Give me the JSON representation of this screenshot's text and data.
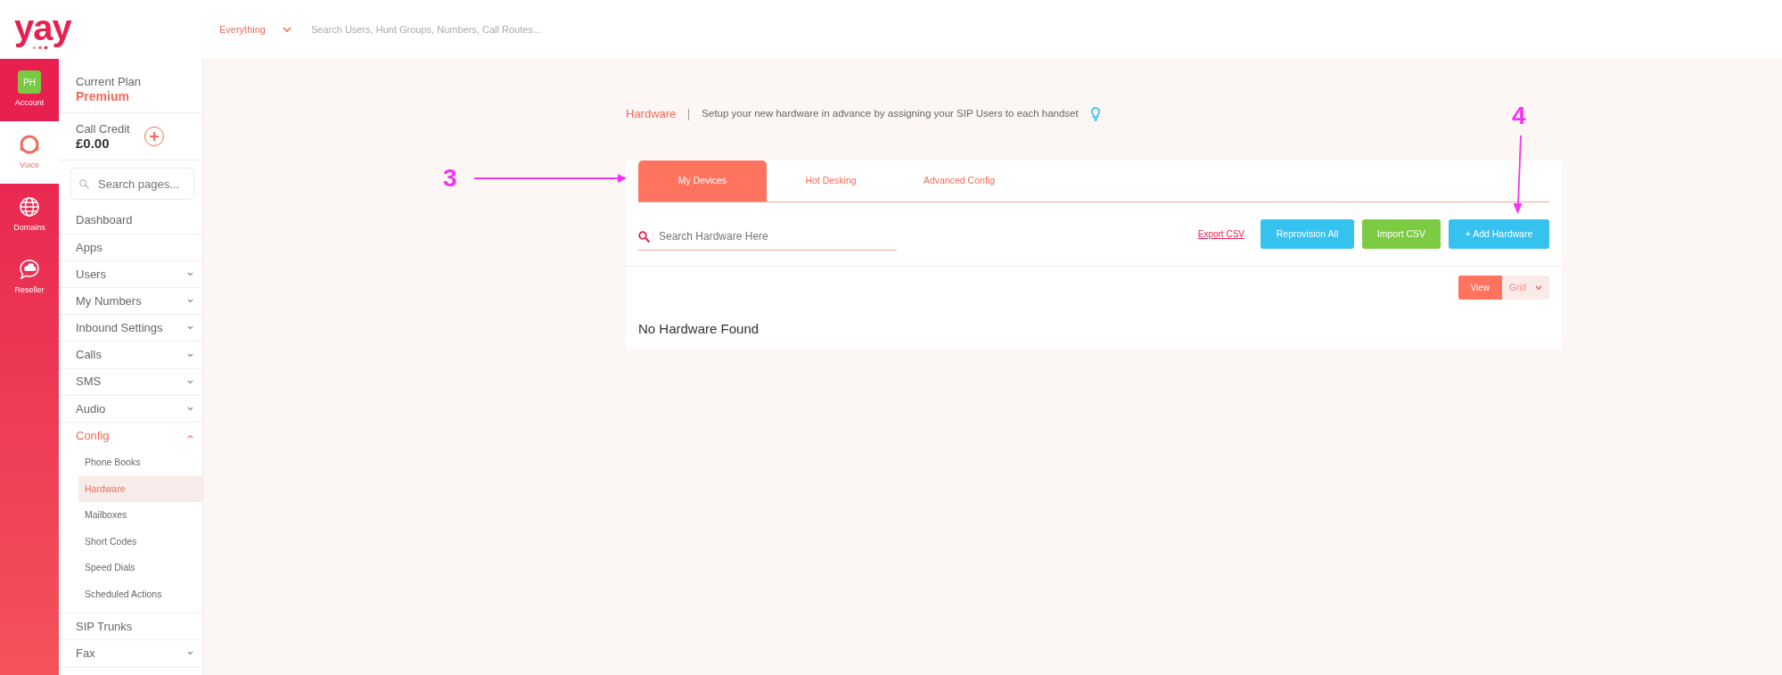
{
  "logo": {
    "text": "yay"
  },
  "header": {
    "scope": "Everything",
    "search_placeholder": "Search Users, Hunt Groups, Numbers, Call Routes..."
  },
  "rail": [
    {
      "label": "Account",
      "avatar": "PH",
      "selected": false
    },
    {
      "label": "Voice",
      "selected": true
    },
    {
      "label": "Domains",
      "selected": false
    },
    {
      "label": "Reseller",
      "selected": false
    }
  ],
  "plan": {
    "label": "Current Plan",
    "value": "Premium"
  },
  "credit": {
    "label": "Call Credit",
    "value": "£0.00"
  },
  "sidebar_search": {
    "placeholder": "Search pages..."
  },
  "nav": [
    {
      "label": "Dashboard"
    },
    {
      "label": "Apps"
    },
    {
      "label": "Users",
      "expanded": false
    },
    {
      "label": "My Numbers",
      "expanded": false
    },
    {
      "label": "Inbound Settings",
      "expanded": false
    },
    {
      "label": "Calls",
      "expanded": false
    },
    {
      "label": "SMS",
      "expanded": false
    },
    {
      "label": "Audio",
      "expanded": false
    },
    {
      "label": "Config",
      "expanded": true,
      "children": [
        {
          "label": "Phone Books",
          "selected": false
        },
        {
          "label": "Hardware",
          "selected": true
        },
        {
          "label": "Mailboxes",
          "selected": false
        },
        {
          "label": "Short Codes",
          "selected": false
        },
        {
          "label": "Speed Dials",
          "selected": false
        },
        {
          "label": "Scheduled Actions",
          "selected": false
        }
      ]
    },
    {
      "label": "SIP Trunks"
    },
    {
      "label": "Fax",
      "expanded": false
    }
  ],
  "page": {
    "title": "Hardware",
    "description": "Setup your new hardware in advance by assigning your SIP Users to each handset",
    "tabs": [
      {
        "label": "My Devices",
        "selected": true
      },
      {
        "label": "Hot Desking",
        "selected": false
      },
      {
        "label": "Advanced Config",
        "selected": false
      }
    ],
    "search": {
      "placeholder": "Search Hardware Here"
    },
    "export_link": "Export CSV",
    "buttons": [
      {
        "label": "Reprovision All",
        "kind": "info"
      },
      {
        "label": "Import CSV",
        "kind": "success"
      },
      {
        "label": "+ Add Hardware",
        "kind": "info"
      }
    ],
    "view_toggle": {
      "label": "View",
      "value": "Grid"
    },
    "empty_message": "No Hardware Found"
  },
  "annotations": [
    {
      "label": "3"
    },
    {
      "label": "4"
    }
  ]
}
